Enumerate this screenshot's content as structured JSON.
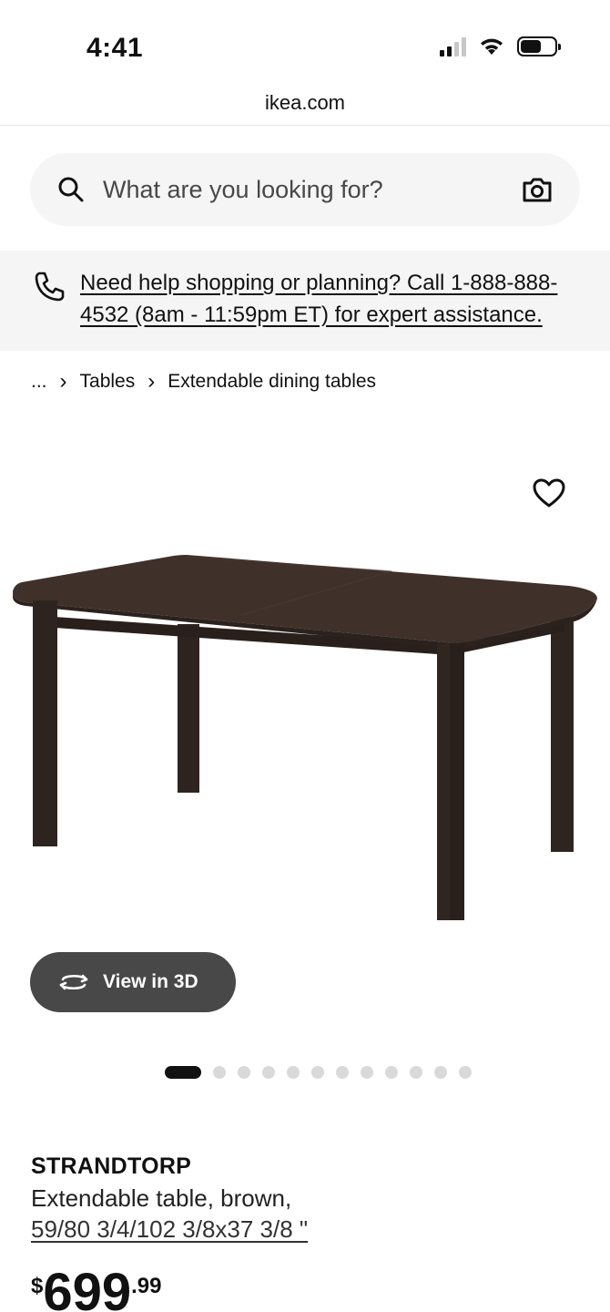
{
  "status_bar": {
    "time": "4:41"
  },
  "browser": {
    "url": "ikea.com"
  },
  "search": {
    "placeholder": "What are you looking for?"
  },
  "help_banner": {
    "text": "Need help shopping or planning? Call 1-888-888-4532 (8am - 11:59pm ET) for expert assistance."
  },
  "breadcrumb": {
    "ellipsis": "...",
    "items": [
      "Tables",
      "Extendable dining tables"
    ]
  },
  "gallery": {
    "view_3d_label": "View in 3D",
    "image_count": 12,
    "active_index": 0
  },
  "product": {
    "name": "STRANDTORP",
    "description": "Extendable table, brown,",
    "size": "59/80 3/4/102 3/8x37 3/8 \"",
    "price_currency": "$",
    "price_main": "699",
    "price_cents": ".99"
  },
  "colors": {
    "accent_dark": "#111111",
    "button_bg": "#484848",
    "banner_bg": "#f5f5f5",
    "table_brown": "#3b2d26"
  }
}
